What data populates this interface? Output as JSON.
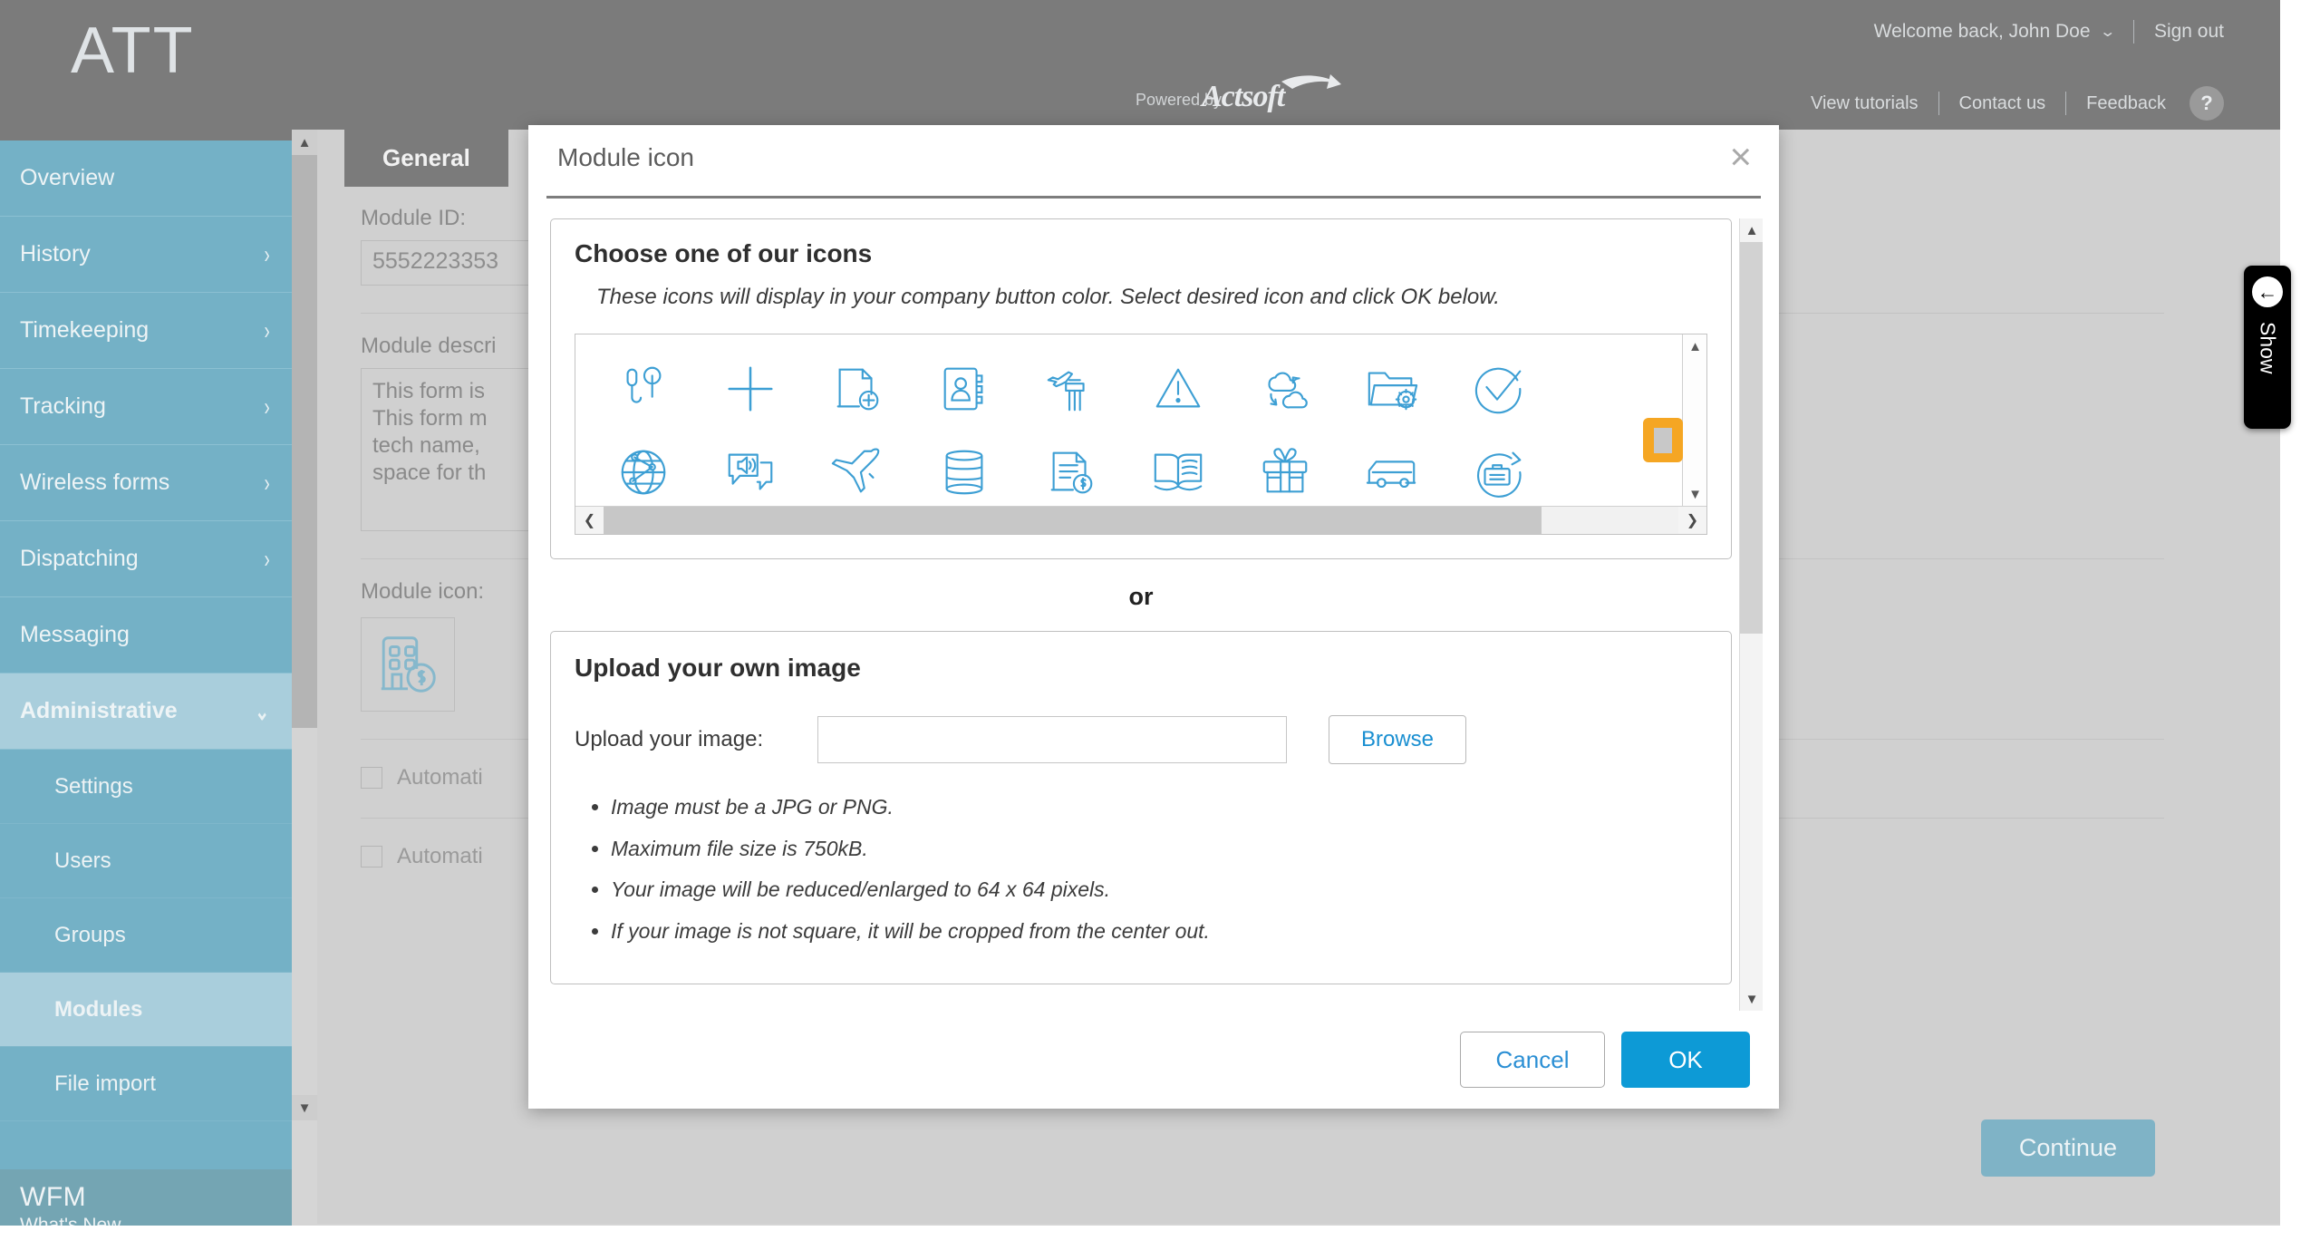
{
  "header": {
    "brand": "ATT",
    "welcome": "Welcome back, John Doe",
    "chevron": "⌄",
    "sign_out": "Sign out",
    "powered_by": "Powered by",
    "actsoft": "Actsoft",
    "view_tutorials": "View tutorials",
    "contact_us": "Contact us",
    "feedback": "Feedback",
    "help": "?"
  },
  "sidebar": {
    "items": [
      {
        "label": "Overview",
        "has_chevron": false
      },
      {
        "label": "History",
        "has_chevron": true
      },
      {
        "label": "Timekeeping",
        "has_chevron": true
      },
      {
        "label": "Tracking",
        "has_chevron": true
      },
      {
        "label": "Wireless forms",
        "has_chevron": true
      },
      {
        "label": "Dispatching",
        "has_chevron": true
      },
      {
        "label": "Messaging",
        "has_chevron": false
      },
      {
        "label": "Administrative",
        "has_chevron": true,
        "expanded": true
      }
    ],
    "sub_items": [
      {
        "label": "Settings",
        "selected": false
      },
      {
        "label": "Users",
        "selected": false
      },
      {
        "label": "Groups",
        "selected": false
      },
      {
        "label": "Modules",
        "selected": true
      },
      {
        "label": "File import",
        "selected": false
      }
    ],
    "footer": {
      "title": "WFM",
      "subtitle": "What's New"
    },
    "chevron_right": "›",
    "chevron_down": "⌄"
  },
  "show_tab": {
    "label": "Show",
    "arrow": "←"
  },
  "main": {
    "tab_general": "General",
    "module_id_label": "Module ID:",
    "module_id_value": "5552223353",
    "module_desc_label": "Module descri",
    "module_desc_value": "This form is\nThis form m\ntech name,\nspace for th",
    "module_icon_label": "Module icon:",
    "checkbox_1": "Automati",
    "checkbox_2": "Automati",
    "continue_label": "Continue"
  },
  "modal": {
    "title": "Module icon",
    "close": "×",
    "icons_section": {
      "heading": "Choose one of our icons",
      "note": "These icons will display in your company button color. Select desired icon and click OK below.",
      "icons": [
        "earbuds-icon",
        "plus-icon",
        "document-add-icon",
        "address-book-icon",
        "airplane-tower-icon",
        "warning-triangle-icon",
        "cloud-sync-icon",
        "folder-settings-icon",
        "check-circle-icon",
        "globe-network-icon",
        "announcement-icon",
        "airplane-icon",
        "barrel-icon",
        "invoice-dollar-icon",
        "open-book-icon",
        "gift-icon",
        "bus-icon",
        "briefcase-refresh-icon"
      ]
    },
    "or_label": "or",
    "upload_section": {
      "heading": "Upload your own image",
      "field_label": "Upload your image:",
      "field_value": "",
      "browse_label": "Browse",
      "rules": [
        "Image must be a JPG or PNG.",
        "Maximum file size is 750kB.",
        "Your image will be reduced/enlarged to 64 x 64 pixels.",
        "If your image is not square, it will be cropped from the center out."
      ]
    },
    "cancel_label": "Cancel",
    "ok_label": "OK"
  },
  "colors": {
    "header_gray": "#7b7b7b",
    "sidebar_blue": "#74b1c6",
    "sidebar_selected": "#a9cedc",
    "icon_blue": "#3d9fd4",
    "ok_blue": "#0d9ad6",
    "link_blue": "#2b8fd4",
    "highlight_orange": "#f5a623"
  }
}
